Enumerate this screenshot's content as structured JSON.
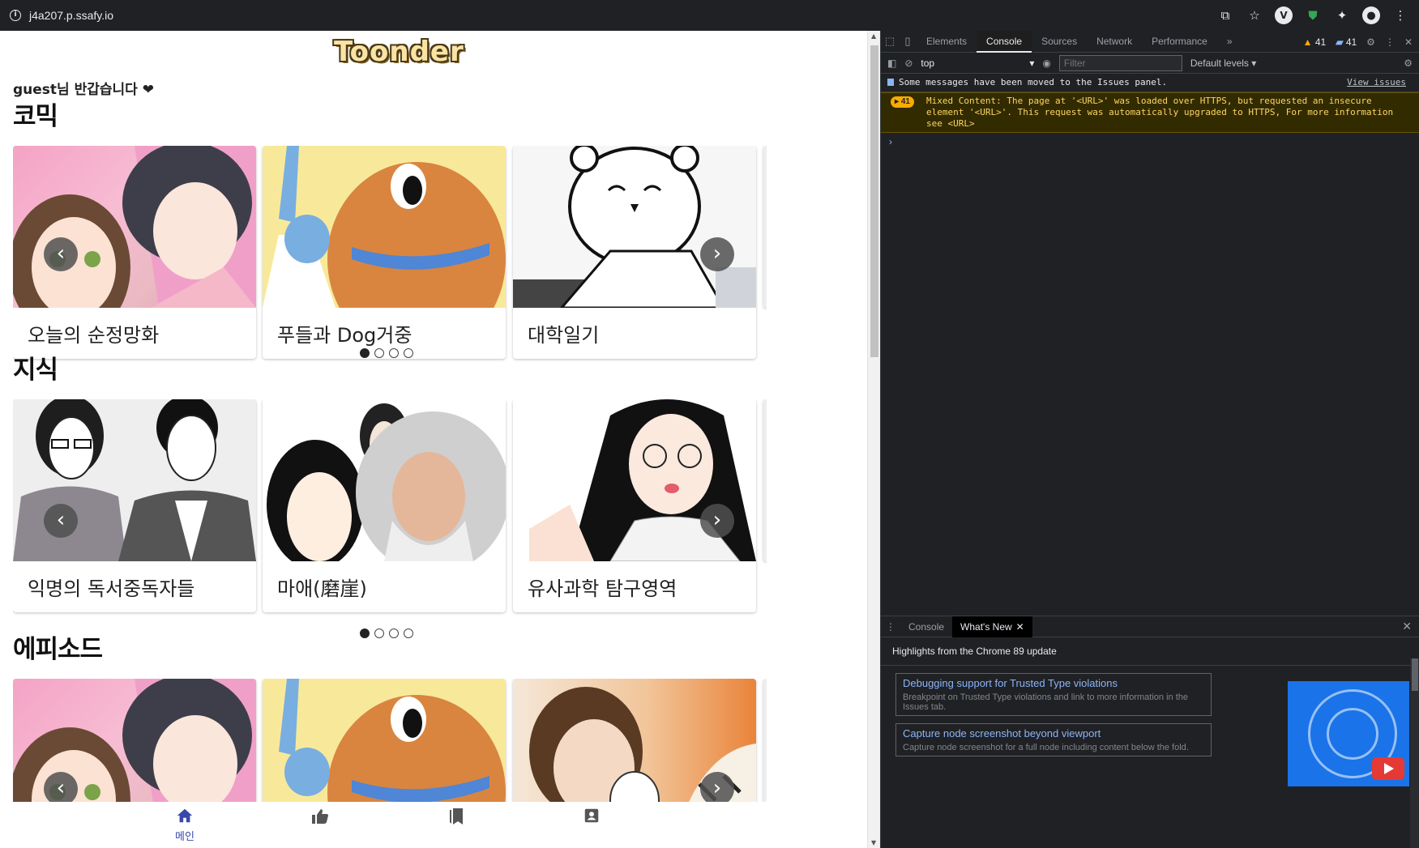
{
  "browser": {
    "url": "j4a207.p.ssafy.io",
    "icons": [
      "translate-icon",
      "star-icon",
      "vpn-icon",
      "shield-icon",
      "extensions-icon",
      "profile-icon",
      "menu-icon"
    ]
  },
  "page": {
    "logo": "Toonder",
    "greeting": "guest님 반갑습니다 ❤",
    "sections": [
      {
        "title": "코믹",
        "cards": [
          "오늘의 순정망화",
          "푸들과 Dog거중",
          "대학일기"
        ],
        "active_dot": 0
      },
      {
        "title": "지식",
        "cards": [
          "익명의 독서중독자들",
          "마애(磨崖)",
          "유사과학 탐구영역"
        ],
        "active_dot": 0
      },
      {
        "title": "에피소드",
        "cards": [
          "",
          "",
          ""
        ]
      }
    ],
    "nav": {
      "prev": "‹",
      "next": "›"
    },
    "bottom_nav": {
      "home_label": "메인",
      "accent": "#3949ab"
    }
  },
  "devtools": {
    "tabs": [
      "Elements",
      "Console",
      "Sources",
      "Network",
      "Performance",
      "»"
    ],
    "active_tab": "Console",
    "warn_count": "41",
    "info_count": "41",
    "context": "top",
    "filter_placeholder": "Filter",
    "levels": "Default levels ▾",
    "issues_msg": "Some messages have been moved to the Issues panel.",
    "issues_link": "View issues",
    "warn_repeat": "41",
    "warn_msg": "Mixed Content: The page at '<URL>' was loaded over HTTPS, but requested an insecure element '<URL>'. This request was automatically upgraded to HTTPS, For more information see <URL>",
    "prompt": "›",
    "drawer": {
      "tabs": [
        "Console",
        "What's New"
      ],
      "active_tab": "What's New",
      "highlights": "Highlights from the Chrome 89 update",
      "items": [
        {
          "title": "Debugging support for Trusted Type violations",
          "desc": "Breakpoint on Trusted Type violations and link to more information in the Issues tab."
        },
        {
          "title": "Capture node screenshot beyond viewport",
          "desc": "Capture node screenshot for a full node including content below the fold."
        }
      ]
    }
  }
}
